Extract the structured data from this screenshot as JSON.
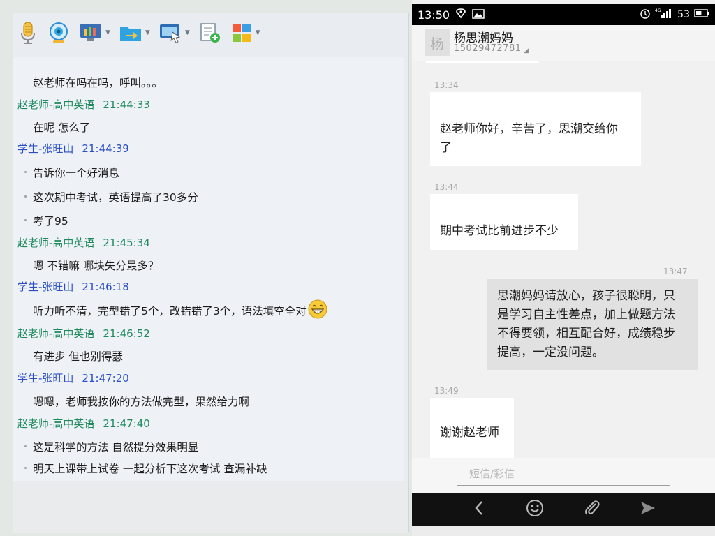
{
  "left_chat": {
    "toolbar_icons": [
      "microphone-icon",
      "webcam-icon",
      "screen-share-icon",
      "file-transfer-icon",
      "remote-desktop-icon",
      "message-edit-icon",
      "apps-grid-icon"
    ],
    "messages": [
      {
        "type": "text",
        "text": "赵老师在吗在吗，呼叫。。。",
        "bullet": false
      },
      {
        "type": "header",
        "role": "teacher",
        "sender": "赵老师-高中英语",
        "time": "21:44:33"
      },
      {
        "type": "text",
        "text": "在呢 怎么了",
        "bullet": false
      },
      {
        "type": "header",
        "role": "student",
        "sender": "学生-张旺山",
        "time": "21:44:39"
      },
      {
        "type": "text",
        "text": "告诉你一个好消息",
        "bullet": true
      },
      {
        "type": "text",
        "text": "这次期中考试，英语提高了30多分",
        "bullet": true
      },
      {
        "type": "text",
        "text": "考了95",
        "bullet": true
      },
      {
        "type": "header",
        "role": "teacher",
        "sender": "赵老师-高中英语",
        "time": "21:45:34"
      },
      {
        "type": "text",
        "text": "嗯 不错嘛 哪块失分最多？",
        "bullet": false
      },
      {
        "type": "header",
        "role": "student",
        "sender": "学生-张旺山",
        "time": "21:46:18"
      },
      {
        "type": "text",
        "text": "听力听不清，完型错了5个，改错错了3个，语法填空全对",
        "bullet": false,
        "emoji": "grin-emoji"
      },
      {
        "type": "header",
        "role": "teacher",
        "sender": "赵老师-高中英语",
        "time": "21:46:52"
      },
      {
        "type": "text",
        "text": "有进步 但也别得瑟",
        "bullet": false
      },
      {
        "type": "header",
        "role": "student",
        "sender": "学生-张旺山",
        "time": "21:47:20"
      },
      {
        "type": "text",
        "text": "嗯嗯，老师我按你的方法做完型，果然给力啊",
        "bullet": false
      },
      {
        "type": "header",
        "role": "teacher",
        "sender": "赵老师-高中英语",
        "time": "21:47:40"
      },
      {
        "type": "text",
        "text": "这是科学的方法 自然提分效果明显",
        "bullet": true
      },
      {
        "type": "text",
        "text": "明天上课带上试卷 一起分析下这次考试 查漏补缺",
        "bullet": true
      }
    ]
  },
  "phone": {
    "status": {
      "time": "13:50",
      "battery": "53",
      "network": "4G"
    },
    "contact": {
      "avatar_char": "杨",
      "name": "杨思潮妈妈",
      "number": "15029472781"
    },
    "thread": [
      {
        "time": "13:34",
        "direction": "in",
        "lines": [
          "赵老师你好，辛苦了，思潮交给你",
          "了"
        ]
      },
      {
        "time": "13:44",
        "direction": "in",
        "lines": [
          "期中考试比前进步不少"
        ]
      },
      {
        "time": "13:47",
        "direction": "out",
        "lines": [
          "思潮妈妈请放心，孩子很聪明，只",
          "是学习自主性差点，加上做题方法",
          "不得要领，相互配合好，成绩稳步",
          "提高，一定没问题。"
        ]
      },
      {
        "time": "13:49",
        "direction": "in",
        "lines": [
          "谢谢赵老师"
        ]
      }
    ],
    "compose_placeholder": "短信/彩信",
    "nav_icons": [
      "back-icon",
      "emoji-icon",
      "attach-icon",
      "send-icon"
    ]
  },
  "colors": {
    "teacher": "#1e8a5c",
    "student": "#2b4ec6",
    "accent": "#2fa7e1"
  }
}
